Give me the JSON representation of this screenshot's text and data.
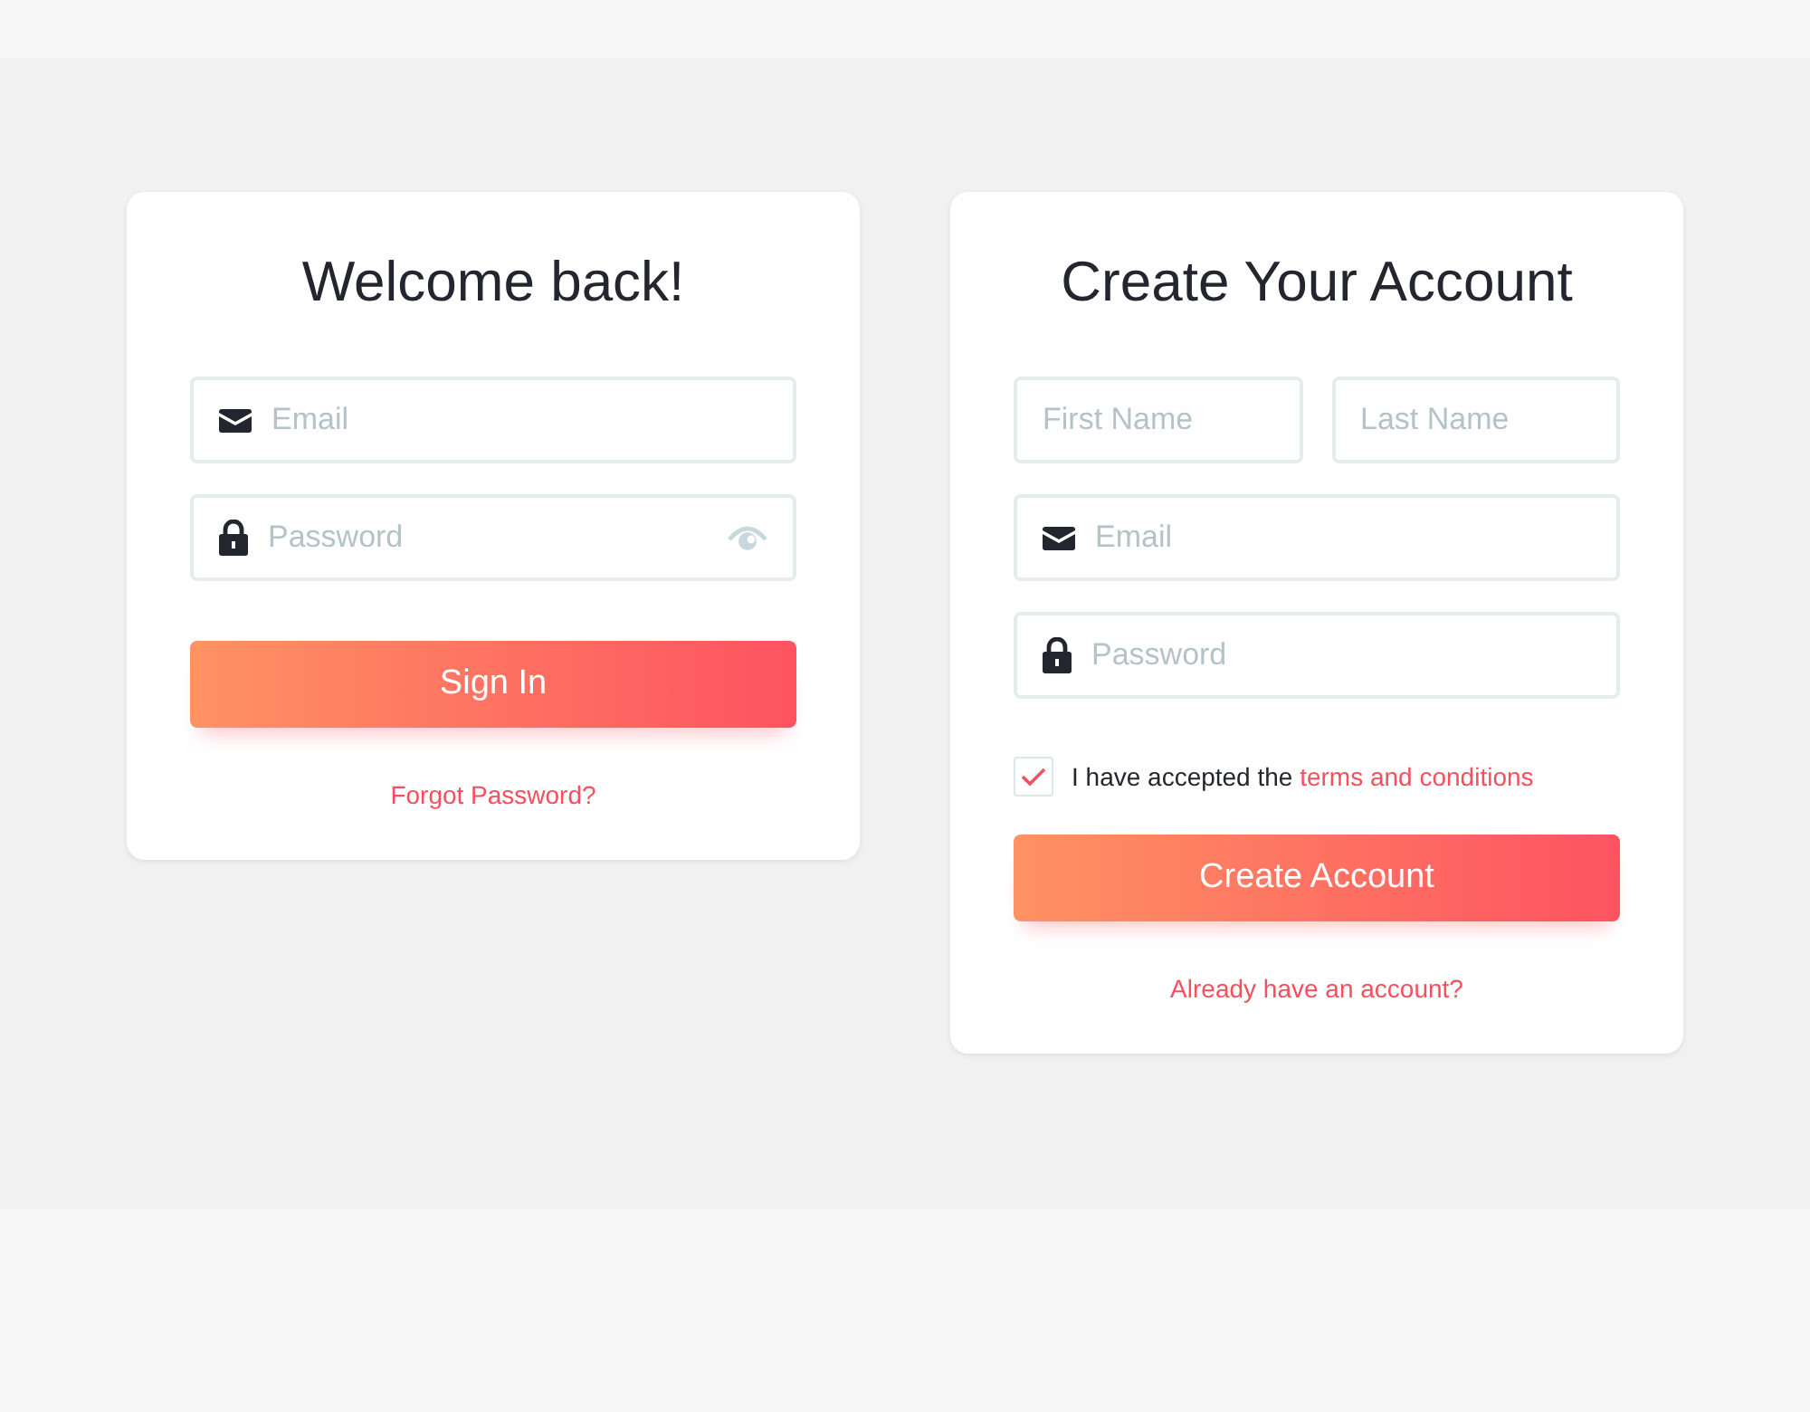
{
  "sign_in": {
    "title": "Welcome back!",
    "fields": [
      {
        "placeholder": "Email",
        "kind": "email",
        "reveal": false
      },
      {
        "placeholder": "Password",
        "kind": "password",
        "reveal": true
      }
    ],
    "button": "Sign In",
    "link": "Forgot Password?"
  },
  "sign_up": {
    "title": "Create Your Account",
    "name_fields": [
      {
        "placeholder": "First Name"
      },
      {
        "placeholder": "Last Name"
      }
    ],
    "fields": [
      {
        "placeholder": "Email",
        "kind": "email",
        "reveal": false
      },
      {
        "placeholder": "Password",
        "kind": "password",
        "reveal": false
      }
    ],
    "terms": {
      "checked": true,
      "text": "I have accepted the",
      "link": "terms and conditions"
    },
    "button": "Create Account",
    "link": "Already have an account?"
  }
}
